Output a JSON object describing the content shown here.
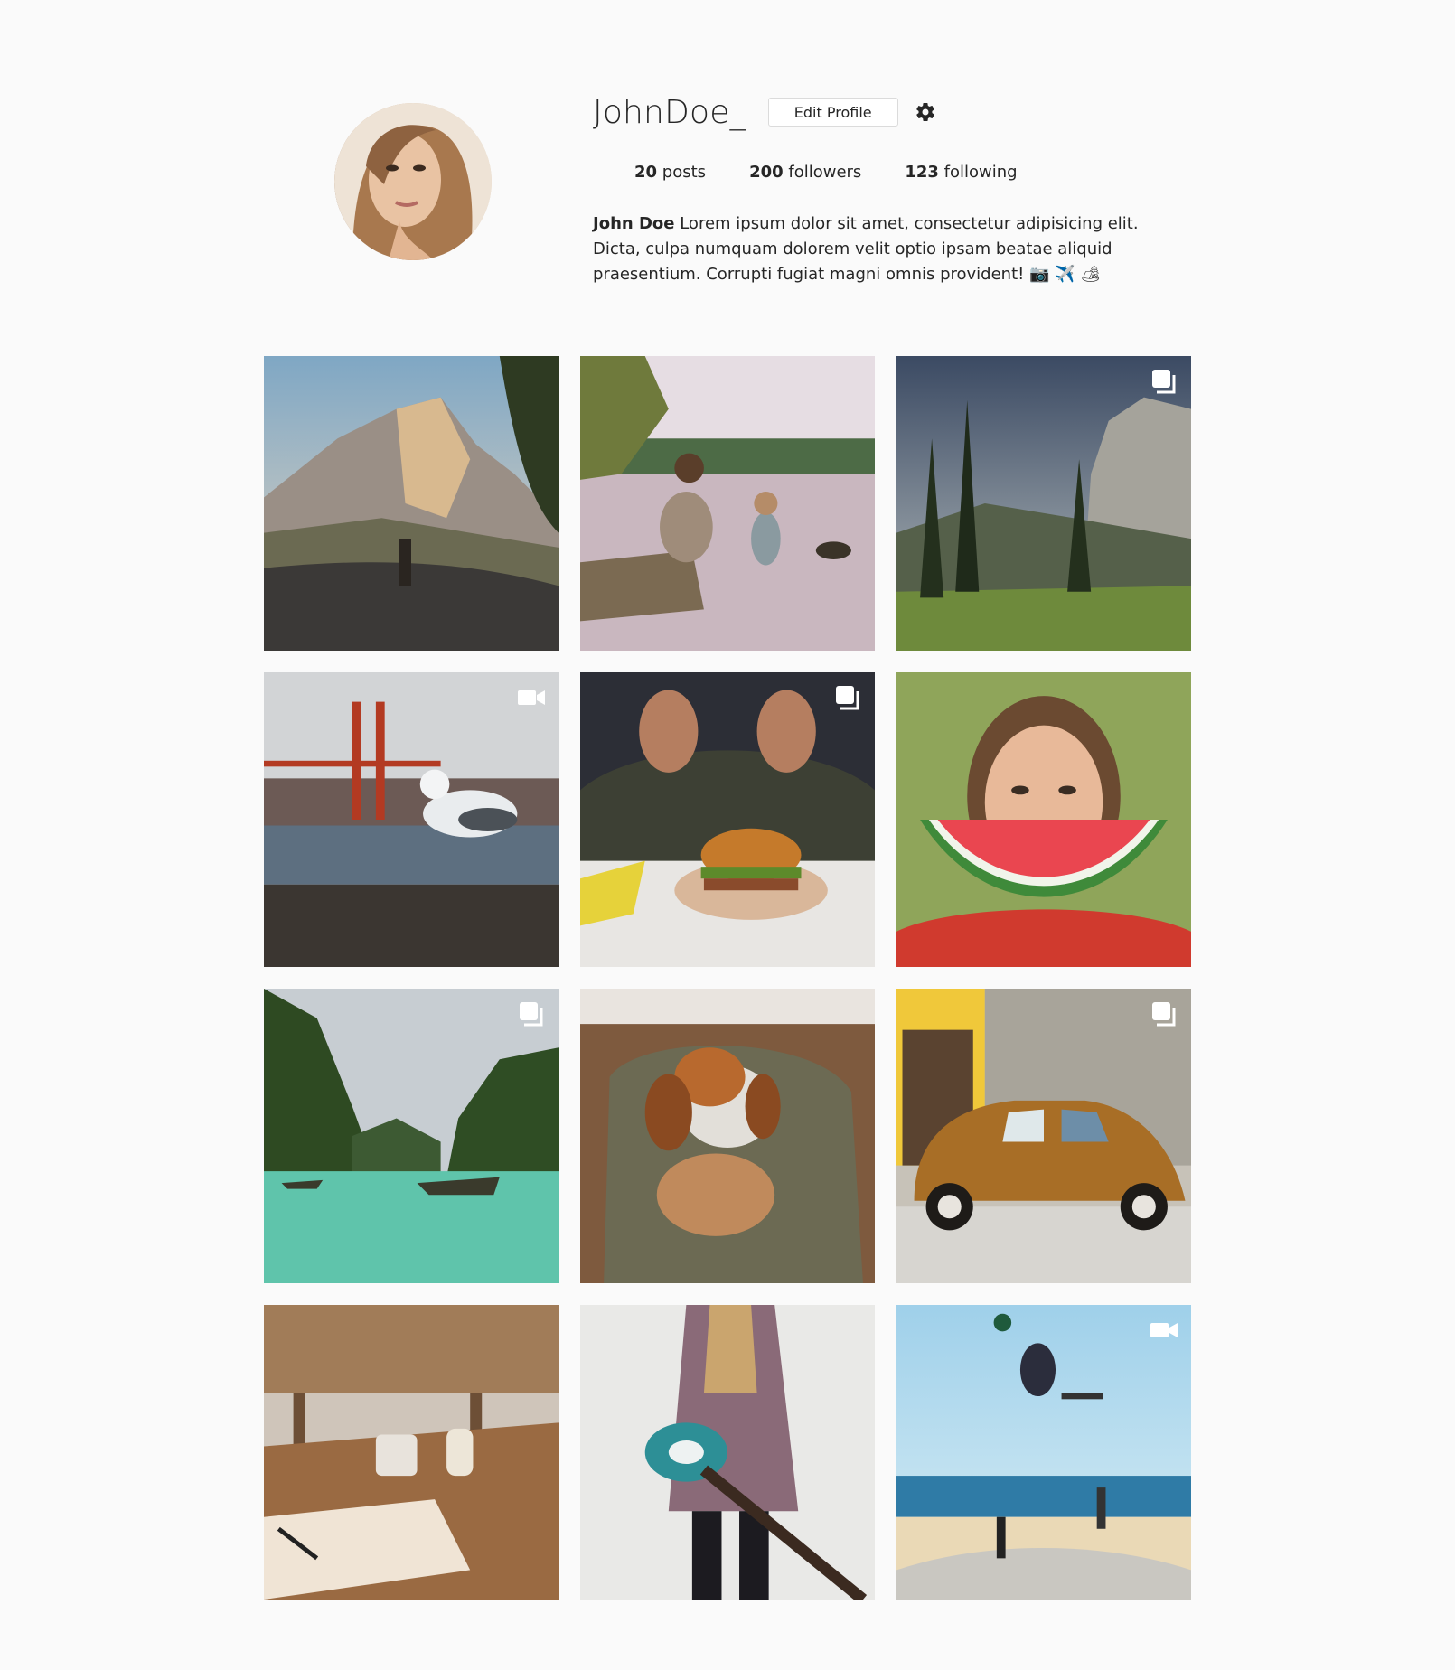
{
  "profile": {
    "username": "JohnDoe_",
    "edit_label": "Edit Profile",
    "stats": {
      "posts_count": "20",
      "posts_label": "posts",
      "followers_count": "200",
      "followers_label": "followers",
      "following_count": "123",
      "following_label": "following"
    },
    "bio_name": "John Doe",
    "bio_text": "Lorem ipsum dolor sit amet, consectetur adipisicing elit. Dicta, culpa numquam dolorem velit optio ipsam beatae aliquid praesentium. Corrupti fugiat magni omnis provident! 📷 ✈️ 🏕"
  },
  "gallery": {
    "posts": [
      {
        "subject": "mountain-road",
        "badge": "none"
      },
      {
        "subject": "lake-family",
        "badge": "none"
      },
      {
        "subject": "yosemite-cliff",
        "badge": "multiple"
      },
      {
        "subject": "seagull-bridge",
        "badge": "video"
      },
      {
        "subject": "burger",
        "badge": "multiple"
      },
      {
        "subject": "watermelon-smile",
        "badge": "none"
      },
      {
        "subject": "lagoon-boats",
        "badge": "multiple"
      },
      {
        "subject": "puppy-backpack",
        "badge": "none"
      },
      {
        "subject": "vintage-beetle",
        "badge": "multiple"
      },
      {
        "subject": "cafe-table",
        "badge": "none"
      },
      {
        "subject": "guitar-woman",
        "badge": "none"
      },
      {
        "subject": "skateboard-beach",
        "badge": "video"
      }
    ]
  },
  "colors": {
    "background": "#fafafa",
    "text": "#262626",
    "border": "#dbdbdb"
  }
}
